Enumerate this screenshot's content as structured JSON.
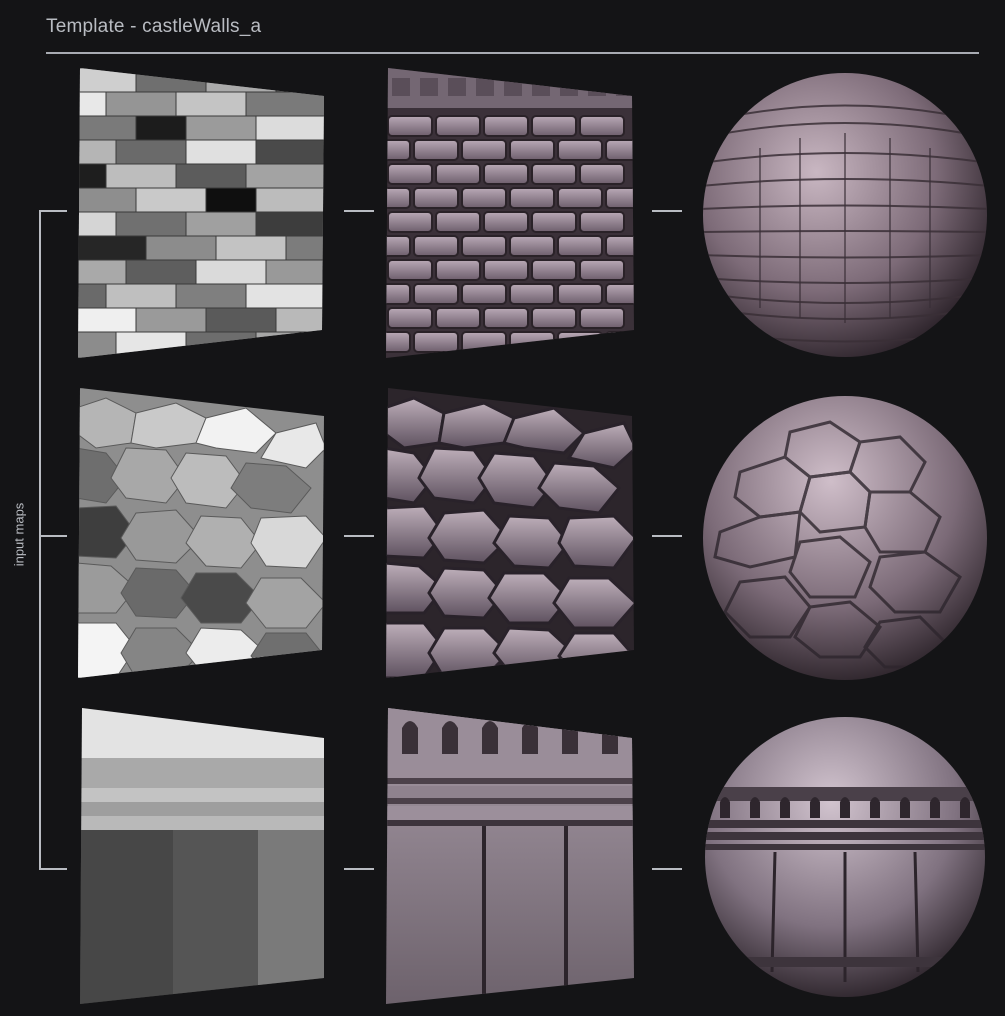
{
  "header": {
    "title": "Template - castleWalls_a"
  },
  "sidebar": {
    "label": "input maps"
  },
  "rows": [
    {
      "input": "brick-heightmap",
      "texture": "brick-wall-texture",
      "preview": "brick-sphere-preview"
    },
    {
      "input": "cobblestone-heightmap",
      "texture": "cobblestone-texture",
      "preview": "cobblestone-sphere-preview"
    },
    {
      "input": "gothic-trim-heightmap",
      "texture": "gothic-trim-texture",
      "preview": "gothic-trim-sphere-preview"
    }
  ],
  "colors": {
    "background": "#141416",
    "line": "#b9bcc2",
    "stone": "#8a7f8c",
    "moss": "#5a6b3a"
  }
}
